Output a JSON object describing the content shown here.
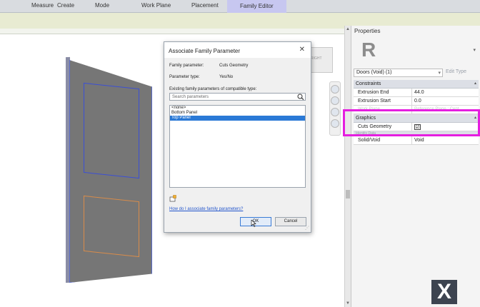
{
  "ribbon": {
    "tabs": [
      "Measure",
      "Create",
      "Mode",
      "Work Plane",
      "Placement",
      "Family Editor"
    ],
    "active_tab": "Family Editor"
  },
  "viewcube": {
    "label": "RIGHT"
  },
  "properties": {
    "title": "Properties",
    "logo": "R",
    "type_selector": "Doors (Void) (1)",
    "edit_type": "Edit Type",
    "sections": [
      {
        "name": "Constraints",
        "rows": [
          {
            "key": "Extrusion End",
            "value": "44.0"
          },
          {
            "key": "Extrusion Start",
            "value": "0.0"
          },
          {
            "key": "Work Plane",
            "value": "Reference Plane : Cent"
          }
        ]
      },
      {
        "name": "Graphics",
        "rows": [
          {
            "key": "Cuts Geometry",
            "value": "☑"
          }
        ]
      },
      {
        "name": "Identity Data",
        "rows": [
          {
            "key": "Solid/Void",
            "value": "Void"
          }
        ]
      }
    ]
  },
  "dialog": {
    "title": "Associate Family Parameter",
    "close": "✕",
    "family_parameter_label": "Family parameter:",
    "family_parameter_value": "Cuts Geometry",
    "parameter_type_label": "Parameter type:",
    "parameter_type_value": "Yes/No",
    "existing_label": "Existing family parameters of compatible type:",
    "search_placeholder": "Search parameters",
    "options": [
      "<none>",
      "Bottom Panel",
      "Top Panel"
    ],
    "selected_option": "Top Panel",
    "help_link": "How do I associate family parameters?",
    "ok": "OK",
    "cancel": "Cancel"
  },
  "watermark": {
    "logo": "X"
  },
  "colors": {
    "highlight": "#e51ee0",
    "selection": "#2a79d6",
    "active_tab": "#c7c7f0"
  }
}
